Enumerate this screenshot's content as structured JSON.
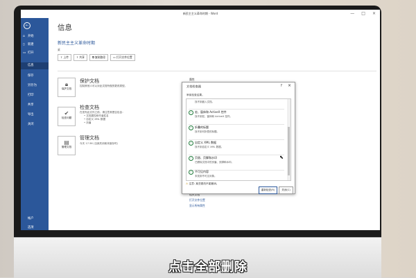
{
  "window": {
    "title": "新民主主义革命时期 - Word"
  },
  "sidebar": {
    "back_icon": "back-arrow-icon",
    "items": [
      {
        "label": "开始"
      },
      {
        "label": "新建"
      },
      {
        "label": "打开"
      },
      {
        "label": "信息"
      },
      {
        "label": "保存"
      },
      {
        "label": "另存为"
      },
      {
        "label": "打印"
      },
      {
        "label": "共享"
      },
      {
        "label": "导出"
      },
      {
        "label": "关闭"
      },
      {
        "label": "帐户"
      },
      {
        "label": "选项"
      }
    ]
  },
  "info": {
    "heading": "信息",
    "doc_title": "新民主主义革命时期",
    "path": "桌",
    "buttons": [
      {
        "label": "上传"
      },
      {
        "label": "共享"
      },
      {
        "label": "复制路径"
      },
      {
        "label": "打开文件位置"
      }
    ],
    "protect": {
      "card_label": "保护文档",
      "title": "保护文档",
      "desc": "控制其他人可以对此文档所做的更改类型。"
    },
    "inspect": {
      "card_label": "检查问题",
      "title": "检查文档",
      "desc": "在发布此文件之前，请注意其是否包含：",
      "bullets": [
        "文档属性和作者姓名",
        "自定义 XML 数据",
        "页眉"
      ]
    },
    "manage": {
      "card_label": "管理文档",
      "title": "管理文档",
      "desc": "今天 17:36 (当我关闭而未保存时)"
    },
    "right": {
      "props_label": "属性",
      "related_label": "相关文档",
      "open_location": "打开文件位置",
      "show_all": "显示所有属性"
    }
  },
  "dialog": {
    "title": "文档检查器",
    "help": "?",
    "close": "×",
    "subtitle": "审阅检查结果。",
    "items": [
      {
        "title": "",
        "desc": "找不到嵌入文档。"
      },
      {
        "title": "宏、窗体和 ActiveX 控件",
        "desc": "找不到宏、窗体和 ActiveX 控件。"
      },
      {
        "title": "折叠的标题",
        "desc": "找不到可折叠的标题。"
      },
      {
        "title": "自定义 XML 数据",
        "desc": "找不到自定义 XML 数据。"
      },
      {
        "title": "页眉、页脚和水印",
        "desc": "已删除文档中的页眉、页脚和水印。"
      },
      {
        "title": "不可见内容",
        "desc": "未找到不可见对象。"
      }
    ],
    "warning": "注意: 某些更改不能撤消。",
    "btn_reinspect": "重新检查(R)",
    "btn_close": "关闭(C)"
  },
  "subtitle": "点击全部删除",
  "colors": {
    "ribbon_blue": "#2b579a",
    "sidebar_active": "#1e3f73",
    "check_green": "#1f7a3a"
  }
}
